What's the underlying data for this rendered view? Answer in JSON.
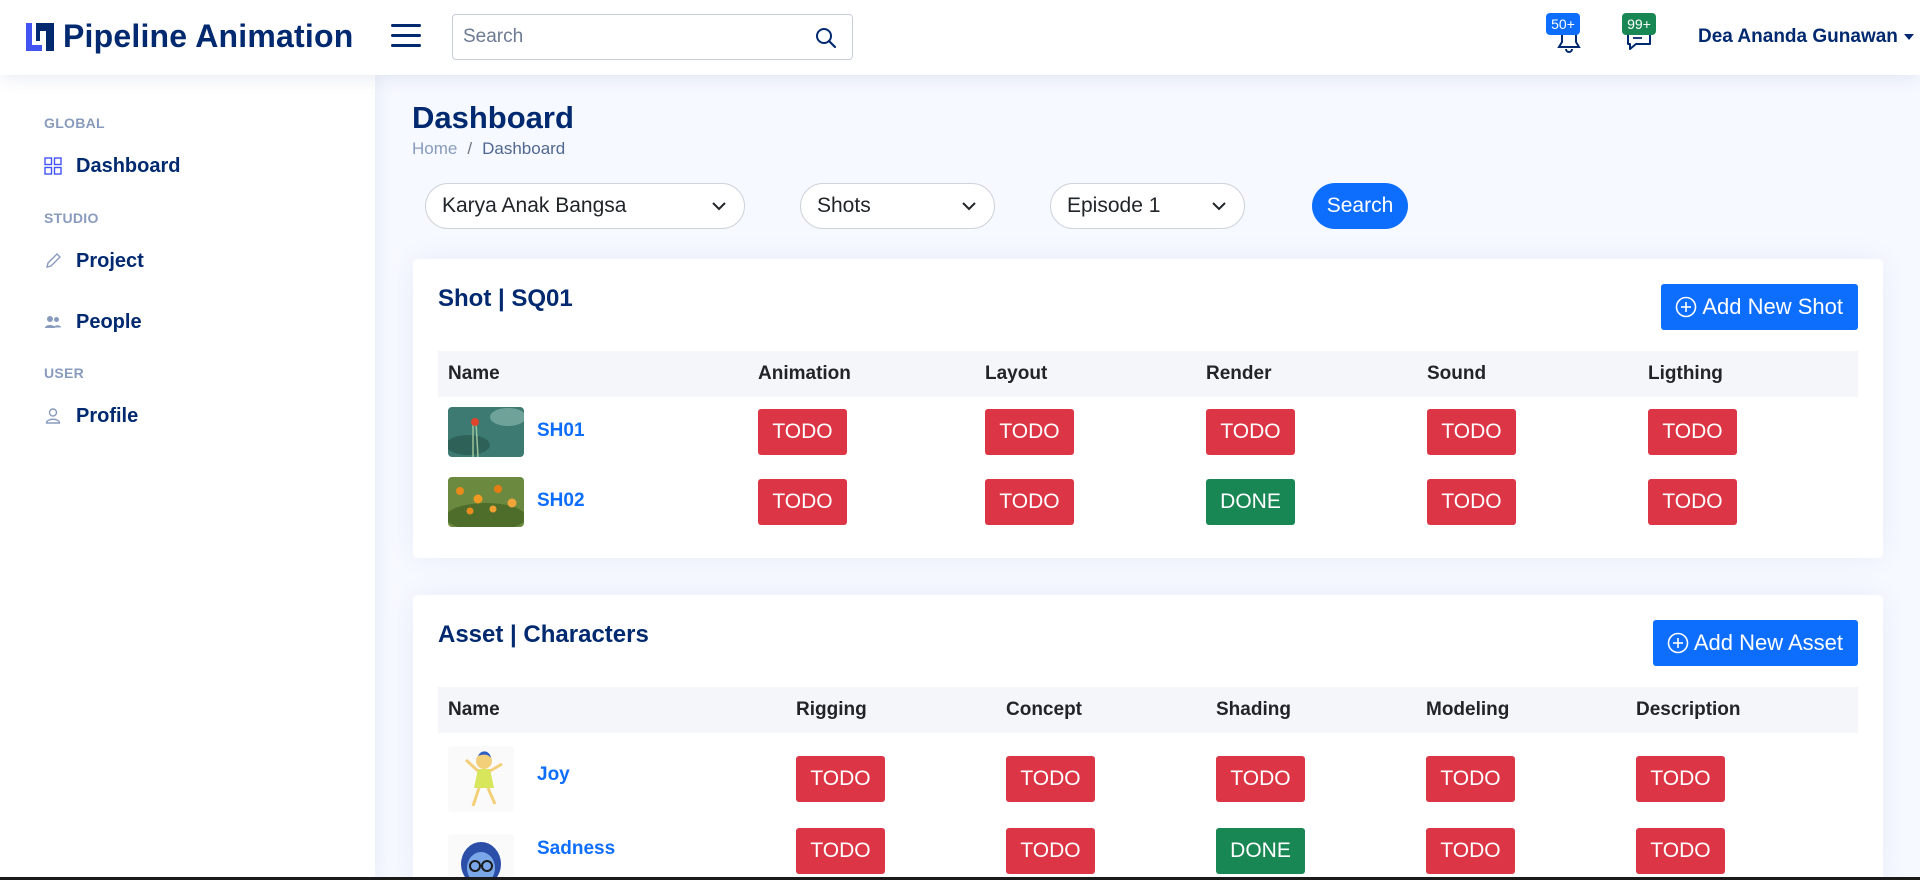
{
  "header": {
    "app_title": "Pipeline Animation",
    "search_placeholder": "Search",
    "notifications_badge": "50+",
    "messages_badge": "99+",
    "user_name": "Dea Ananda Gunawan"
  },
  "sidebar": {
    "sections": [
      {
        "heading": "GLOBAL",
        "items": [
          {
            "label": "Dashboard",
            "icon": "grid-icon"
          }
        ]
      },
      {
        "heading": "STUDIO",
        "items": [
          {
            "label": "Project",
            "icon": "pencil-icon"
          },
          {
            "label": "People",
            "icon": "people-icon"
          }
        ]
      },
      {
        "heading": "USER",
        "items": [
          {
            "label": "Profile",
            "icon": "person-icon"
          }
        ]
      }
    ]
  },
  "page": {
    "title": "Dashboard",
    "breadcrumb": [
      "Home",
      "Dashboard"
    ]
  },
  "filters": {
    "project": "Karya Anak Bangsa",
    "type": "Shots",
    "episode": "Episode 1",
    "search_label": "Search"
  },
  "shots_card": {
    "title": "Shot | SQ01",
    "add_label": "Add New Shot",
    "columns": [
      "Name",
      "Animation",
      "Layout",
      "Render",
      "Sound",
      "Ligthing"
    ],
    "rows": [
      {
        "name": "SH01",
        "statuses": [
          "TODO",
          "TODO",
          "TODO",
          "TODO",
          "TODO"
        ]
      },
      {
        "name": "SH02",
        "statuses": [
          "TODO",
          "TODO",
          "DONE",
          "TODO",
          "TODO"
        ]
      }
    ]
  },
  "assets_card": {
    "title": "Asset | Characters",
    "add_label": "Add New Asset",
    "columns": [
      "Name",
      "Rigging",
      "Concept",
      "Shading",
      "Modeling",
      "Description"
    ],
    "rows": [
      {
        "name": "Joy",
        "statuses": [
          "TODO",
          "TODO",
          "TODO",
          "TODO",
          "TODO"
        ]
      },
      {
        "name": "Sadness",
        "statuses": [
          "TODO",
          "TODO",
          "DONE",
          "TODO",
          "TODO"
        ]
      }
    ]
  },
  "colors": {
    "brand": "#012970",
    "primary": "#0d6efd",
    "todo": "#dc3545",
    "done": "#198754"
  }
}
